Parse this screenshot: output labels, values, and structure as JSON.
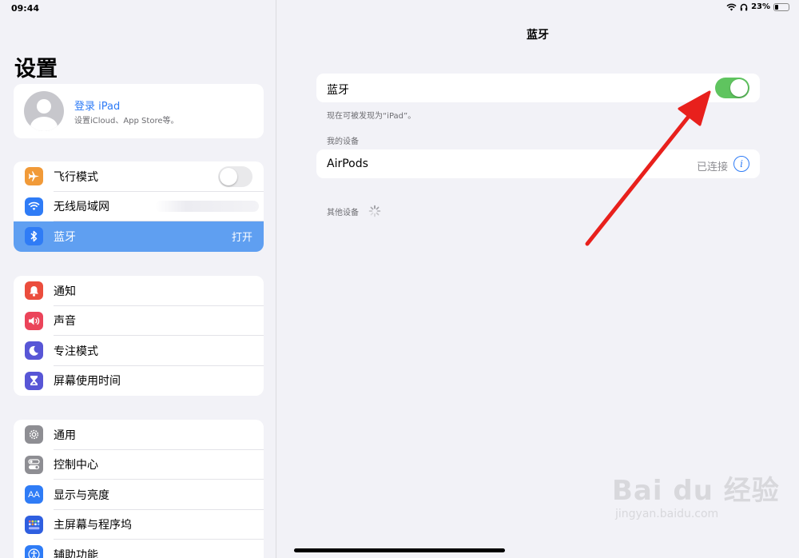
{
  "status_bar": {
    "time": "09:44",
    "battery": "23%",
    "battery_level": 0.23
  },
  "sidebar": {
    "title": "设置",
    "profile": {
      "name": "登录 iPad",
      "subtitle": "设置iCloud、App Store等。"
    },
    "group1": [
      {
        "label": "飞行模式",
        "icon": "airplane-icon",
        "color": "#f19a38",
        "toggle": false
      },
      {
        "label": "无线局域网",
        "icon": "wifi-icon",
        "color": "#2f7cf6",
        "value": ""
      },
      {
        "label": "蓝牙",
        "icon": "bluetooth-icon",
        "color": "#2f7cf6",
        "value": "打开",
        "selected": true
      }
    ],
    "group2": [
      {
        "label": "通知",
        "icon": "bell-icon",
        "color": "#eb4d3d"
      },
      {
        "label": "声音",
        "icon": "speaker-icon",
        "color": "#eb445a"
      },
      {
        "label": "专注模式",
        "icon": "moon-icon",
        "color": "#5856d6"
      },
      {
        "label": "屏幕使用时间",
        "icon": "hourglass-icon",
        "color": "#5856d6"
      }
    ],
    "group3": [
      {
        "label": "通用",
        "icon": "gear-icon",
        "color": "#8e8e93"
      },
      {
        "label": "控制中心",
        "icon": "switches-icon",
        "color": "#8e8e93"
      },
      {
        "label": "显示与亮度",
        "icon": "text-size-icon",
        "color": "#2f7cf6"
      },
      {
        "label": "主屏幕与程序坞",
        "icon": "grid-icon",
        "color": "#2f5fe0"
      },
      {
        "label": "辅助功能",
        "icon": "accessibility-icon",
        "color": "#2f7cf6"
      }
    ]
  },
  "main": {
    "title": "蓝牙",
    "bluetooth_label": "蓝牙",
    "bluetooth_on": true,
    "discover_note": "现在可被发现为“iPad”。",
    "my_devices_header": "我的设备",
    "my_devices": [
      {
        "name": "AirPods",
        "status": "已连接"
      }
    ],
    "other_devices_header": "其他设备"
  },
  "watermark": {
    "main": "Bai du 经验",
    "sub": "jingyan.baidu.com"
  },
  "colors": {
    "accent": "#2f7cf6",
    "toggle_on": "#5fc45f",
    "selected_row": "#5f9ff1",
    "arrow": "#e8201c"
  }
}
